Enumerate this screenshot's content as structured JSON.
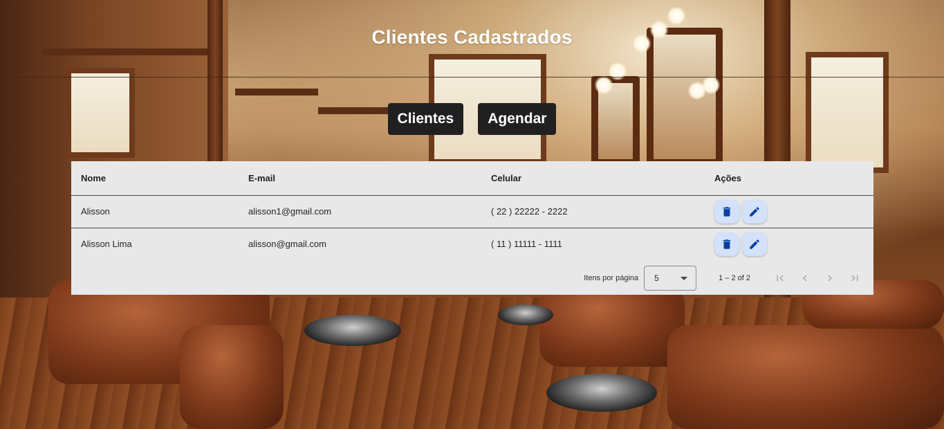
{
  "header": {
    "title": "Clientes Cadastrados"
  },
  "nav": {
    "clientes_label": "Clientes",
    "agendar_label": "Agendar"
  },
  "table": {
    "columns": [
      "Nome",
      "E-mail",
      "Celular",
      "Ações"
    ],
    "rows": [
      {
        "nome": "Alisson",
        "email": "alisson1@gmail.com",
        "celular": "( 22 ) 22222 - 2222"
      },
      {
        "nome": "Alisson Lima",
        "email": "alisson@gmail.com",
        "celular": "( 11 ) 11111 - 1111"
      }
    ],
    "action_icons": [
      "delete-icon",
      "edit-icon"
    ]
  },
  "paginator": {
    "items_per_page_label": "Itens por página",
    "page_size": "5",
    "range_label": "1 – 2 of 2"
  },
  "colors": {
    "nav_button_bg": "#202020",
    "table_bg": "#e8e8e8",
    "action_button_bg": "#d3e1fb",
    "action_icon": "#0a3f9c"
  }
}
